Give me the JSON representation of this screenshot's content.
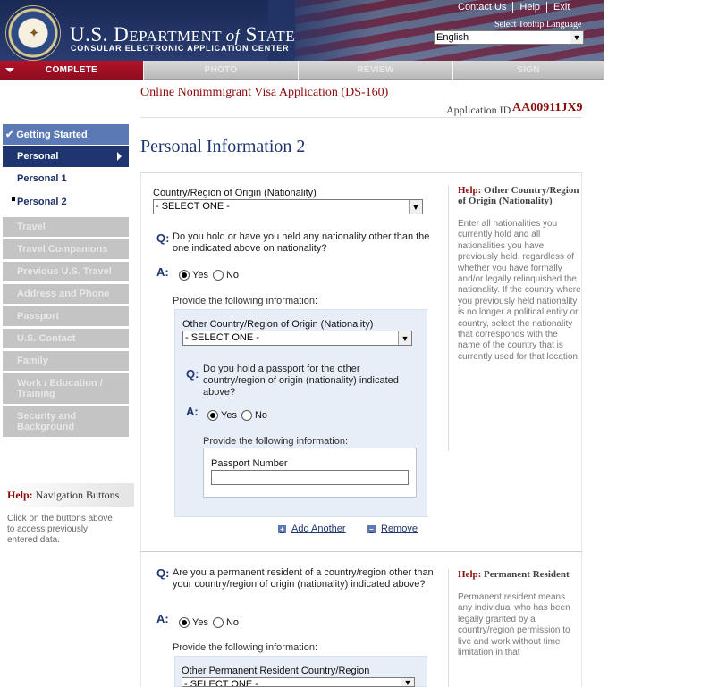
{
  "header": {
    "links": [
      "Contact Us",
      "Help",
      "Exit"
    ],
    "dept_title": "U.S. DEPARTMENT of STATE",
    "dept_title_parts": {
      "a": "U.S. D",
      "b": "EPARTMENT ",
      "c": "of",
      "d": " S",
      "e": "TATE"
    },
    "dept_subtitle": "CONSULAR ELECTRONIC APPLICATION CENTER",
    "tooltip_language_label": "Select Tooltip Language",
    "tooltip_language_value": "English"
  },
  "progress": {
    "steps": [
      "COMPLETE",
      "PHOTO",
      "REVIEW",
      "SIGN"
    ],
    "active": "COMPLETE"
  },
  "sidebar": {
    "items": [
      {
        "label": "Getting Started",
        "state": "completed"
      },
      {
        "label": "Personal",
        "state": "current"
      },
      {
        "label": "Personal 1",
        "state": "sub"
      },
      {
        "label": "Personal 2",
        "state": "sub-current"
      },
      {
        "label": "Travel",
        "state": "disabled"
      },
      {
        "label": "Travel Companions",
        "state": "disabled"
      },
      {
        "label": "Previous U.S. Travel",
        "state": "disabled"
      },
      {
        "label": "Address and Phone",
        "state": "disabled"
      },
      {
        "label": "Passport",
        "state": "disabled"
      },
      {
        "label": "U.S. Contact",
        "state": "disabled"
      },
      {
        "label": "Family",
        "state": "disabled"
      },
      {
        "label": "Work / Education / Training",
        "state": "disabled"
      },
      {
        "label": "Security and Background",
        "state": "disabled"
      }
    ],
    "help_title_prefix": "Help:",
    "help_title": "Navigation Buttons",
    "help_text": "Click on the buttons above to access previously entered data."
  },
  "main": {
    "app_title": "Online Nonimmigrant Visa Application (DS-160)",
    "app_id_label": "Application ID",
    "app_id": "AA00911JX9",
    "page_title": "Personal Information 2",
    "nationality_label": "Country/Region of Origin (Nationality)",
    "nationality_value": "- SELECT ONE -",
    "q_marker": "Q:",
    "a_marker": "A:",
    "q1": "Do you hold or have you held any nationality other than the one indicated above on nationality?",
    "yes": "Yes",
    "no": "No",
    "q1_answer": "Yes",
    "provide": "Provide the following information:",
    "other_nat_label": "Other Country/Region of Origin (Nationality)",
    "other_nat_value": "- SELECT ONE -",
    "q2": "Do you hold a passport for the other country/region of origin (nationality) indicated above?",
    "q2_answer": "Yes",
    "passport_label": "Passport Number",
    "passport_value": "",
    "add_another": "Add Another",
    "remove": "Remove",
    "q3": "Are you a permanent resident of a country/region other than your country/region of origin (nationality) indicated above?",
    "q3_answer": "Yes",
    "perm_label": "Other Permanent Resident Country/Region",
    "perm_value": "- SELECT ONE -"
  },
  "help_panels": [
    {
      "prefix": "Help:",
      "title": "Other Country/Region of Origin (Nationality)",
      "body": "Enter all nationalities you currently hold and all nationalities you have previously held, regardless of whether you have formally and/or legally relinquished the nationality. If the country where you previously held nationality is no longer a political entity or country, select the nationality that corresponds with the name of the country that is currently used for that location."
    },
    {
      "prefix": "Help:",
      "title": "Permanent Resident",
      "body": "Permanent resident means any individual who has been legally granted by a country/region permission to live and work without time limitation in that"
    }
  ],
  "colors": {
    "header_navy": "#223466",
    "accent_red": "#8b0b0b",
    "nav_current": "#1e3570",
    "nav_completed": "#5b7ab5",
    "nav_disabled": "#c4c4c4",
    "panel_blue": "#e7eef7"
  }
}
